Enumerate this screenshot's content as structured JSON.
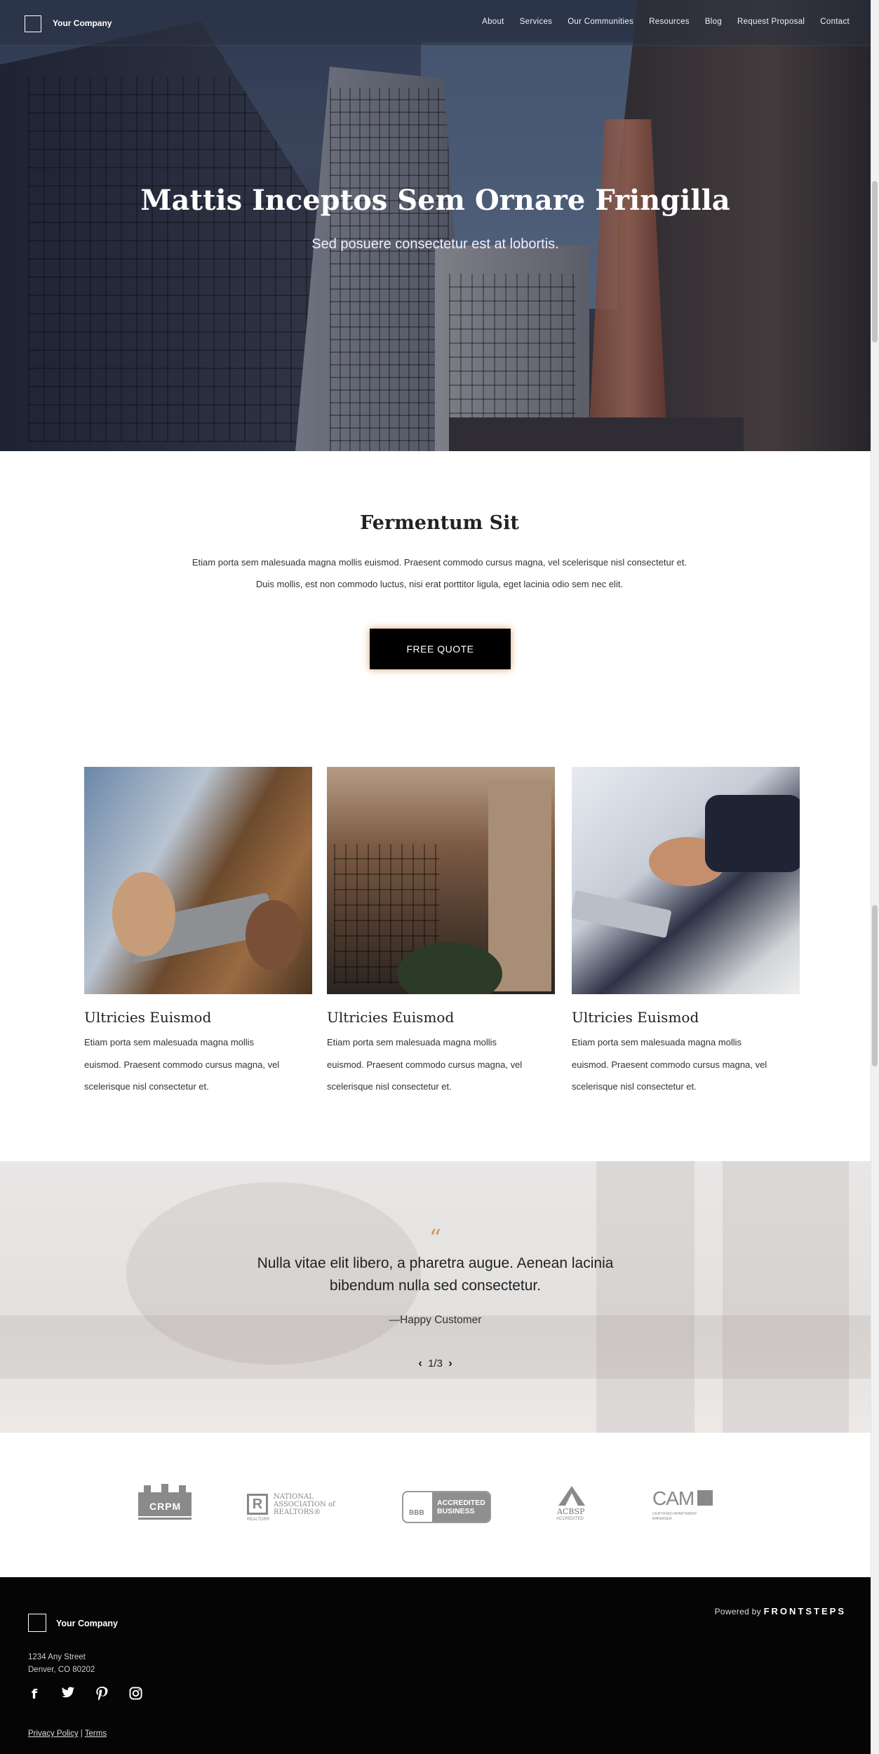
{
  "header": {
    "company": "Your Company",
    "nav": [
      "About",
      "Services",
      "Our Communities",
      "Resources",
      "Blog",
      "Request Proposal",
      "Contact"
    ]
  },
  "hero": {
    "title": "Mattis Inceptos Sem Ornare Fringilla",
    "subtitle": "Sed posuere consectetur est at lobortis."
  },
  "intro": {
    "title": "Fermentum Sit",
    "body": "Etiam porta sem malesuada magna mollis euismod. Praesent commodo cursus magna, vel scelerisque nisl consectetur et. Duis mollis, est non commodo luctus, nisi erat porttitor ligula, eget lacinia odio sem nec elit.",
    "button": "FREE QUOTE"
  },
  "cards": [
    {
      "title": "Ultricies Euismod",
      "body": "Etiam porta sem malesuada magna mollis euismod. Praesent commodo cursus magna, vel scelerisque nisl consectetur et."
    },
    {
      "title": "Ultricies Euismod",
      "body": "Etiam porta sem malesuada magna mollis euismod. Praesent commodo cursus magna, vel scelerisque nisl consectetur et."
    },
    {
      "title": "Ultricies Euismod",
      "body": "Etiam porta sem malesuada magna mollis euismod. Praesent commodo cursus magna, vel scelerisque nisl consectetur et."
    }
  ],
  "testimonial": {
    "quote_mark": "“",
    "text": "Nulla vitae elit libero, a pharetra augue. Aenean lacinia bibendum nulla sed consectetur.",
    "author": "—Happy Customer",
    "pager": "1/3"
  },
  "logos": {
    "crpm": "CRPM",
    "nar": "NATIONAL ASSOCIATION of REALTORS®",
    "nar_mark": "R",
    "realtor": "REALTOR®",
    "bbb": "ACCREDITED BUSINESS",
    "bbb_mark": "BBB",
    "acbsp": "ACBSP",
    "acbsp_sub": "ACCREDITED",
    "cam": "CAM",
    "cam_sub": "CERTIFIED APARTMENT MANAGER"
  },
  "footer": {
    "company": "Your Company",
    "powered_by": "Powered by",
    "brand": "FRONTSTEPS",
    "address_line1": "1234 Any Street",
    "address_line2": "Denver, CO 80202",
    "social": [
      "facebook-icon",
      "twitter-icon",
      "pinterest-icon",
      "instagram-icon"
    ],
    "privacy": "Privacy Policy",
    "separator": "|",
    "terms": "Terms"
  },
  "colors": {
    "accent_quote": "#c89b5b",
    "button_bg": "#000000",
    "footer_bg": "#050505"
  }
}
